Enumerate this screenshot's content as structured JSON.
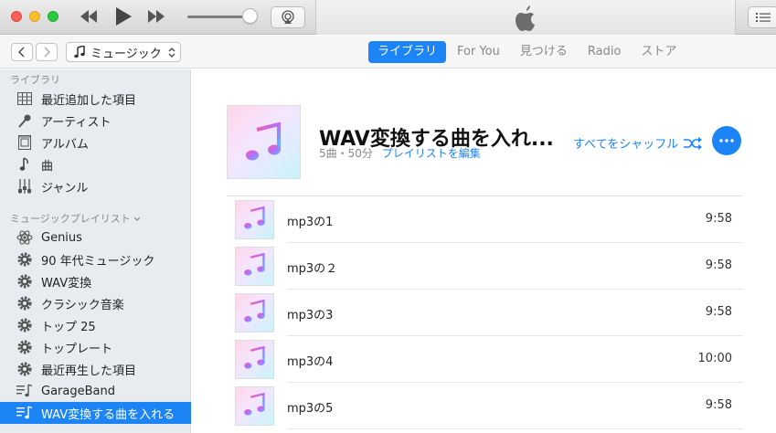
{
  "toolbar": {
    "apple_logo": "apple-icon"
  },
  "navbar": {
    "media_type": "ミュージック",
    "tabs": [
      {
        "label": "ライブラリ",
        "active": true
      },
      {
        "label": "For You",
        "active": false
      },
      {
        "label": "見つける",
        "active": false
      },
      {
        "label": "Radio",
        "active": false
      },
      {
        "label": "ストア",
        "active": false
      }
    ]
  },
  "sidebar": {
    "library_header": "ライブラリ",
    "library_items": [
      {
        "label": "最近追加した項目",
        "icon": "grid-icon"
      },
      {
        "label": "アーティスト",
        "icon": "microphone-icon"
      },
      {
        "label": "アルバム",
        "icon": "album-icon"
      },
      {
        "label": "曲",
        "icon": "note-icon"
      },
      {
        "label": "ジャンル",
        "icon": "guitar-icon"
      }
    ],
    "playlists_header": "ミュージックプレイリスト",
    "playlist_items": [
      {
        "label": "Genius",
        "icon": "genius-icon",
        "selected": false
      },
      {
        "label": "90 年代ミュージック",
        "icon": "gear-icon",
        "selected": false
      },
      {
        "label": "WAV変換",
        "icon": "gear-icon",
        "selected": false
      },
      {
        "label": "クラシック音楽",
        "icon": "gear-icon",
        "selected": false
      },
      {
        "label": "トップ 25",
        "icon": "gear-icon",
        "selected": false
      },
      {
        "label": "トップレート",
        "icon": "gear-icon",
        "selected": false
      },
      {
        "label": "最近再生した項目",
        "icon": "gear-icon",
        "selected": false
      },
      {
        "label": "GarageBand",
        "icon": "playlist-icon",
        "selected": false
      },
      {
        "label": "WAV変換する曲を入れる",
        "icon": "playlist-icon",
        "selected": true
      }
    ]
  },
  "playlist": {
    "title": "WAV変換する曲を入れ...",
    "meta": "5曲・50分",
    "edit_label": "プレイリストを編集",
    "shuffle_label": "すべてをシャッフル",
    "songs": [
      {
        "name": "mp3の1",
        "duration": "9:58"
      },
      {
        "name": "mp3の２",
        "duration": "9:58"
      },
      {
        "name": "mp3の3",
        "duration": "9:58"
      },
      {
        "name": "mp3の4",
        "duration": "10:00"
      },
      {
        "name": "mp3の5",
        "duration": "9:58"
      }
    ]
  },
  "colors": {
    "accent": "#1d84f6",
    "sidebar_bg": "#e8ecf1"
  }
}
